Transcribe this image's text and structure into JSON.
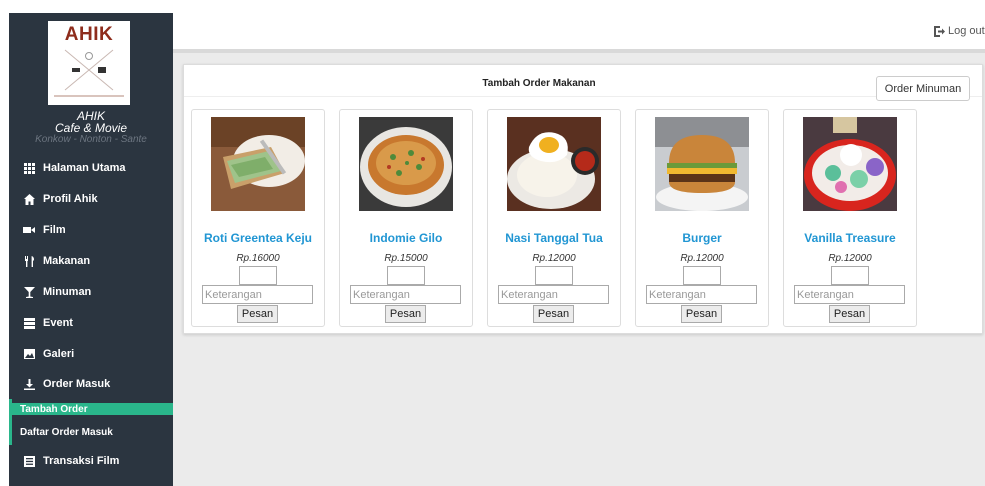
{
  "app": {
    "logo_title": "AHIK",
    "logo_tagline": "BANGKOK NOODLE MOVIE",
    "brand_name": "AHIK",
    "brand_sub": "Cafe & Movie",
    "brand_tag": "Konkow - Nonton - Sante"
  },
  "sidebar": {
    "items": [
      {
        "label": "Halaman Utama",
        "icon": "grid-icon"
      },
      {
        "label": "Profil Ahik",
        "icon": "home-icon"
      },
      {
        "label": "Film",
        "icon": "video-camera-icon"
      },
      {
        "label": "Makanan",
        "icon": "cutlery-icon"
      },
      {
        "label": "Minuman",
        "icon": "glass-icon"
      },
      {
        "label": "Event",
        "icon": "list-icon"
      },
      {
        "label": "Galeri",
        "icon": "image-icon"
      },
      {
        "label": "Order Masuk",
        "icon": "download-icon"
      }
    ],
    "submenu": [
      {
        "label": "Tambah Order",
        "active": true
      },
      {
        "label": "Daftar Order Masuk",
        "active": false
      }
    ],
    "last_item": {
      "label": "Transaksi Film",
      "icon": "list-alt-icon"
    },
    "accent_color": "#2ab68b",
    "bg_color": "#2b3540"
  },
  "header": {
    "logout_label": "Log out",
    "logout_icon": "logout-icon"
  },
  "panel": {
    "title": "Tambah Order Makanan",
    "order_minuman_label": "Order Minuman"
  },
  "foods": [
    {
      "name": "Roti Greentea Keju",
      "price": "Rp.16000",
      "placeholder": "Keterangan",
      "button": "Pesan"
    },
    {
      "name": "Indomie Gilo",
      "price": "Rp.15000",
      "placeholder": "Keterangan",
      "button": "Pesan"
    },
    {
      "name": "Nasi Tanggal Tua",
      "price": "Rp.12000",
      "placeholder": "Keterangan",
      "button": "Pesan"
    },
    {
      "name": "Burger",
      "price": "Rp.12000",
      "placeholder": "Keterangan",
      "button": "Pesan"
    },
    {
      "name": "Vanilla Treasure",
      "price": "Rp.12000",
      "placeholder": "Keterangan",
      "button": "Pesan"
    }
  ],
  "colors": {
    "link_blue": "#2196d3",
    "logo_red": "#8e2c1c"
  }
}
